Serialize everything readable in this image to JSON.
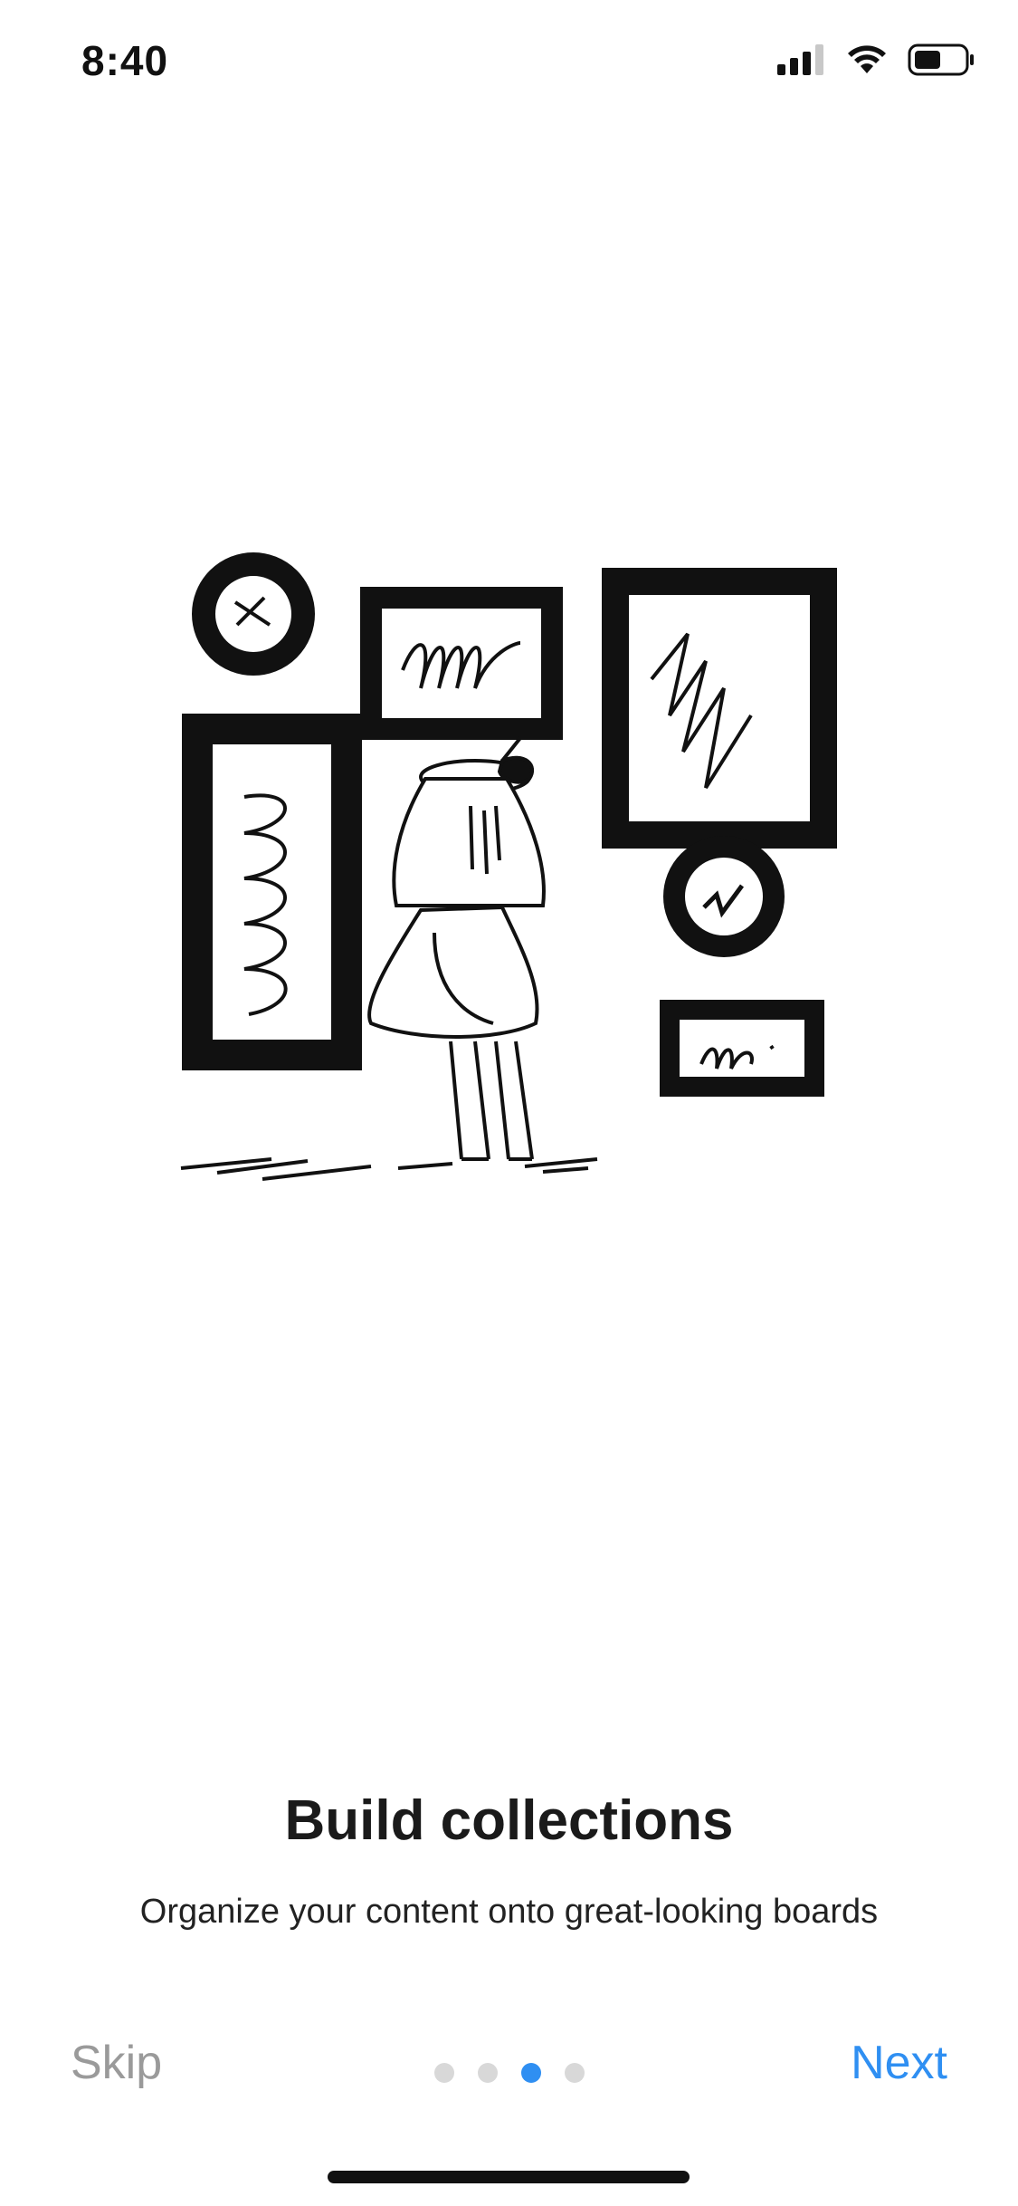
{
  "status_bar": {
    "time": "8:40",
    "icons": [
      "signal-icon",
      "wifi-icon",
      "battery-icon"
    ]
  },
  "onboarding": {
    "illustration": "gallery-illustration",
    "title": "Build collections",
    "subtitle": "Organize your content onto great-looking boards"
  },
  "navigation": {
    "skip_label": "Skip",
    "next_label": "Next",
    "page_count": 4,
    "current_page": 3
  },
  "colors": {
    "accent": "#2f8ff2",
    "muted": "#9a9a9a",
    "dot_inactive": "#d8d8d8"
  }
}
